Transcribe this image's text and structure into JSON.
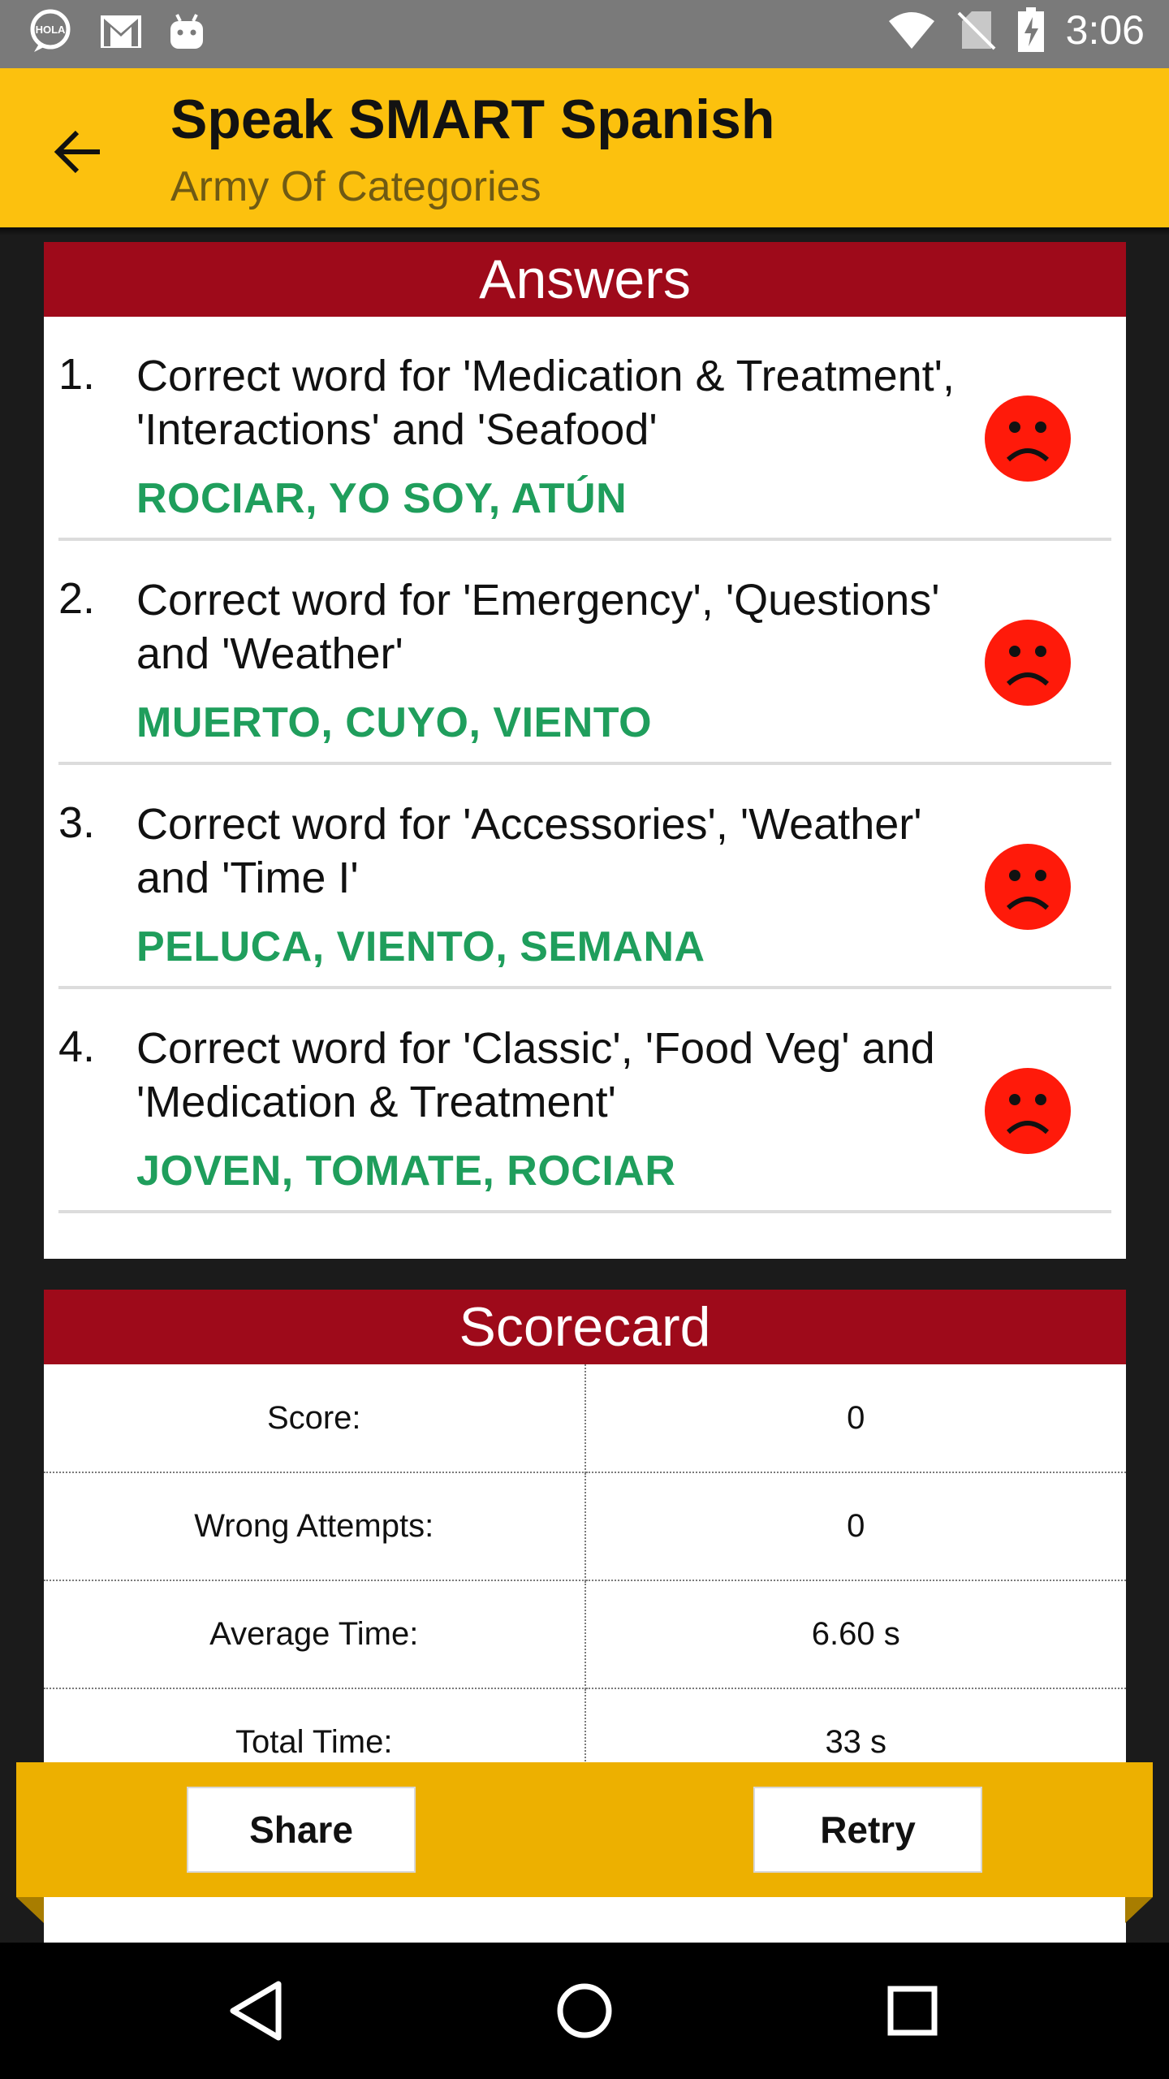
{
  "status_bar": {
    "time": "3:06",
    "left_icons": [
      "hola-icon",
      "gmail-icon",
      "android-icon"
    ],
    "right_icons": [
      "wifi-icon",
      "no-sim-icon",
      "battery-charging-icon"
    ]
  },
  "app_bar": {
    "title": "Speak SMART Spanish",
    "subtitle": "Army Of Categories",
    "back_icon": "arrow-back-icon"
  },
  "answers": {
    "header": "Answers",
    "items": [
      {
        "num": "1.",
        "question": "Correct word for 'Medication & Treatment', 'Interactions' and 'Seafood'",
        "answer": "ROCIAR, YO SOY, ATÚN",
        "result_icon": "sad-face-icon"
      },
      {
        "num": "2.",
        "question": "Correct word for 'Emergency', 'Questions' and 'Weather'",
        "answer": "MUERTO, CUYO, VIENTO",
        "result_icon": "sad-face-icon"
      },
      {
        "num": "3.",
        "question": "Correct word for 'Accessories', 'Weather' and 'Time I'",
        "answer": "PELUCA, VIENTO, SEMANA",
        "result_icon": "sad-face-icon"
      },
      {
        "num": "4.",
        "question": "Correct word for 'Classic', 'Food Veg' and 'Medication & Treatment'",
        "answer": "JOVEN, TOMATE, ROCIAR",
        "result_icon": "sad-face-icon"
      }
    ]
  },
  "scorecard": {
    "header": "Scorecard",
    "rows": [
      {
        "label": "Score:",
        "value": "0"
      },
      {
        "label": "Wrong Attempts:",
        "value": "0"
      },
      {
        "label": "Average Time:",
        "value": "6.60 s"
      },
      {
        "label": "Total Time:",
        "value": "33 s"
      }
    ]
  },
  "actions": {
    "share_label": "Share",
    "retry_label": "Retry"
  },
  "nav": {
    "icons": [
      "nav-back-icon",
      "nav-home-icon",
      "nav-recents-icon"
    ]
  },
  "colors": {
    "app_bar": "#fcc10e",
    "header_red": "#9e0a1a",
    "answer_green": "#1f9e5c",
    "sad_face": "#ff1a0a",
    "action_bar": "#edb000"
  }
}
